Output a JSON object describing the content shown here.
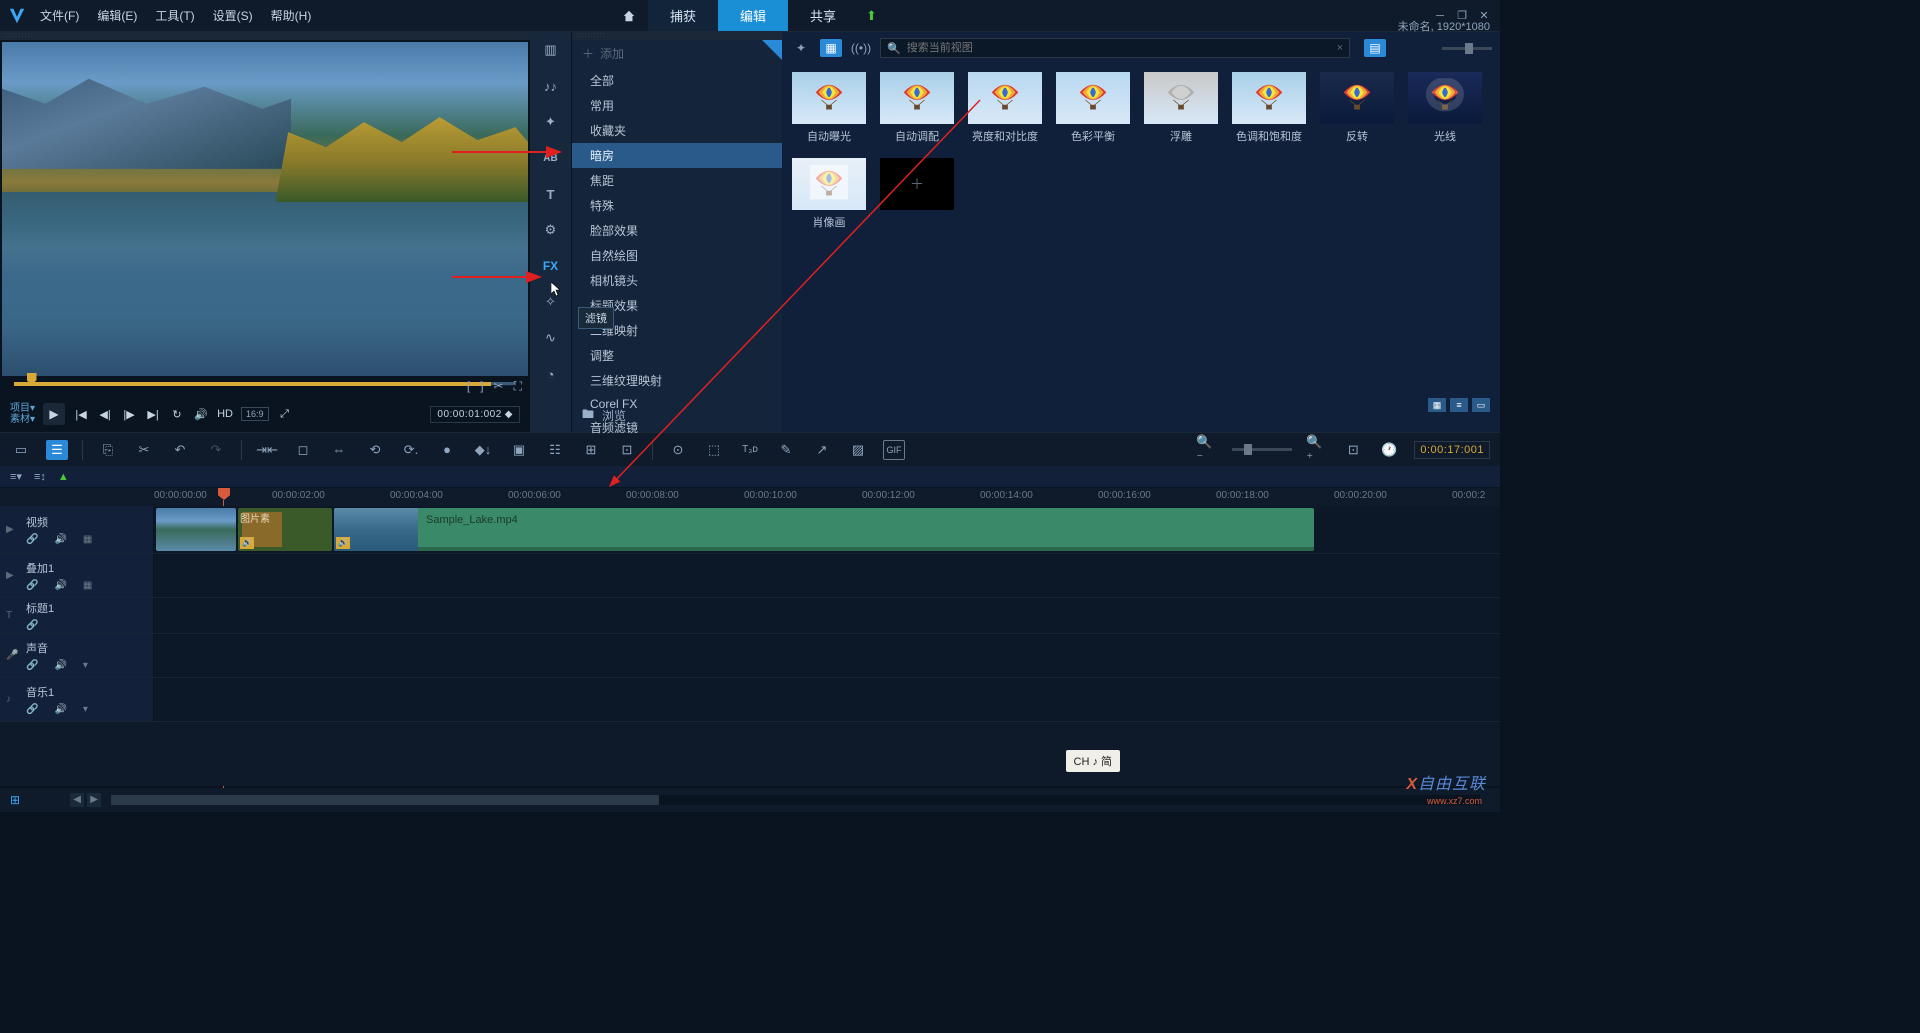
{
  "menu": {
    "file": "文件(F)",
    "edit": "编辑(E)",
    "tool": "工具(T)",
    "setting": "设置(S)",
    "help": "帮助(H)"
  },
  "tabs": {
    "capture": "捕获",
    "edit": "编辑",
    "share": "共享"
  },
  "title_right": "未命名, 1920*1080",
  "preview": {
    "proj": "项目▾",
    "mat": "素材▾",
    "hd": "HD",
    "ar": "16:9",
    "time": "00:00:01:002",
    "frames": "◆"
  },
  "cat_tooltip": "滤镜",
  "filter_add": "添加",
  "filter_list": [
    "全部",
    "常用",
    "收藏夹",
    "暗房",
    "焦距",
    "特殊",
    "脸部效果",
    "自然绘图",
    "相机镜头",
    "标题效果",
    "二维映射",
    "调整",
    "三维纹理映射",
    "Corel FX",
    "音频滤镜"
  ],
  "filter_browse": "浏览",
  "search_placeholder": "搜索当前视图",
  "thumbs": [
    {
      "label": "自动曝光",
      "sky": "#a8d0e8"
    },
    {
      "label": "自动调配",
      "sky": "#a8d0e8"
    },
    {
      "label": "亮度和对比度",
      "sky": "#b8d8f0"
    },
    {
      "label": "色彩平衡",
      "sky": "#b8d8f0"
    },
    {
      "label": "浮雕",
      "sky": "#c8c8c8",
      "mono": true
    },
    {
      "label": "色调和饱和度",
      "sky": "#a8d0e8"
    },
    {
      "label": "反转",
      "sky": "#1a2a4a",
      "dark": true
    },
    {
      "label": "光线",
      "sky": "#1a2a5a",
      "dark": true,
      "spot": true
    },
    {
      "label": "肖像画",
      "sky": "#e8f0f8",
      "soft": true
    }
  ],
  "ruler_ticks": [
    "00:00:00:00",
    "00:00:02:00",
    "00:00:04:00",
    "00:00:06:00",
    "00:00:08:00",
    "00:00:10:00",
    "00:00:12:00",
    "00:00:14:00",
    "00:00:16:00",
    "00:00:18:00",
    "00:00:20:00",
    "00:00:2"
  ],
  "timeline_tc": "0:00:17:001",
  "tracks": {
    "video": "视频",
    "overlay": "叠加1",
    "title": "标题1",
    "voice": "声音",
    "music": "音乐1"
  },
  "clip_img2": "图片素",
  "clip_vid": "Sample_Lake.mp4",
  "ime": "CH ♪ 简",
  "watermark": "自由互联",
  "watermark2": "www.xz7.com"
}
